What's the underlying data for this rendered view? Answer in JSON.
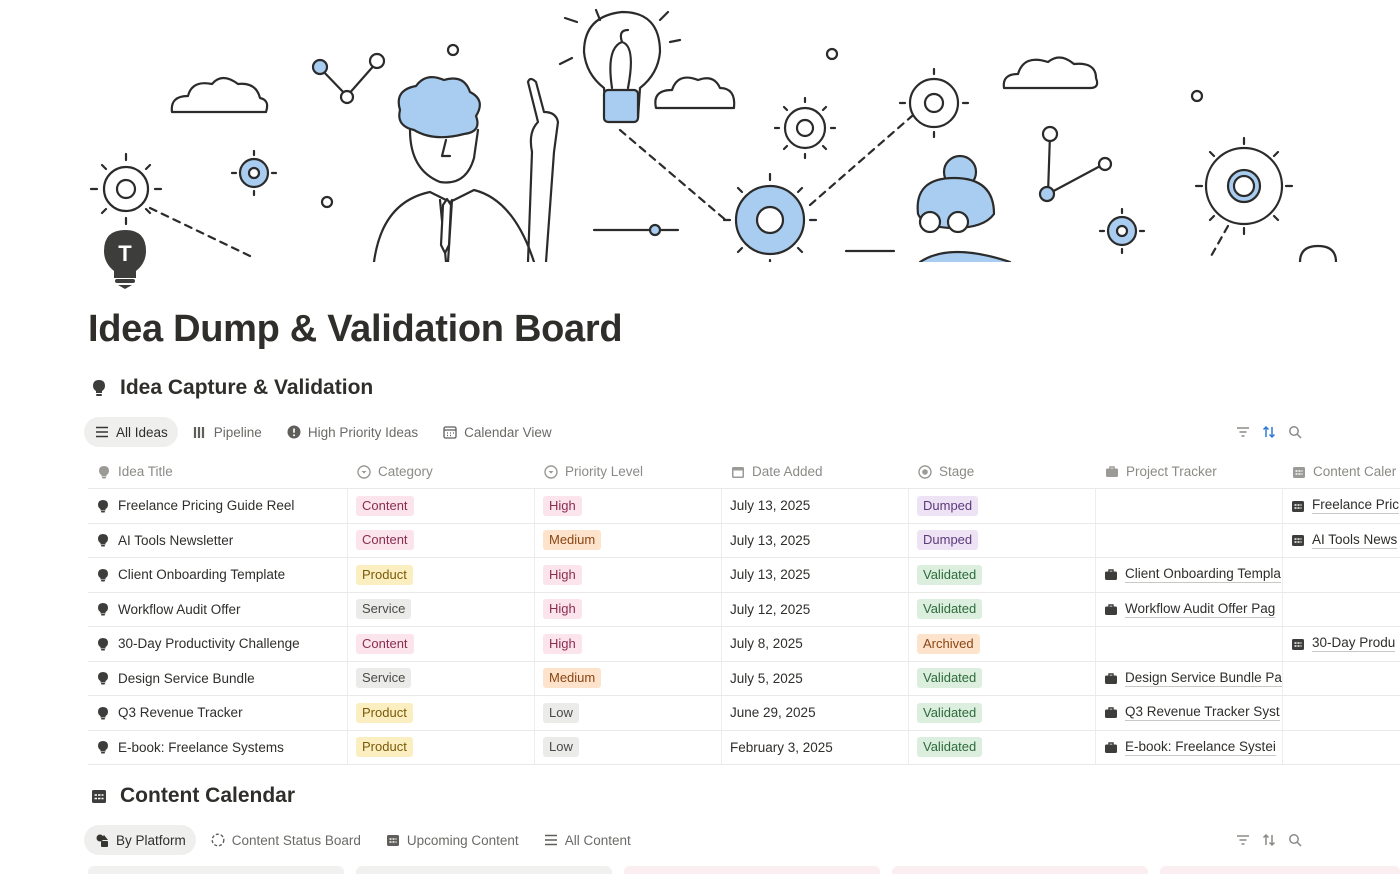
{
  "page": {
    "title": "Idea Dump & Validation Board",
    "icon": "lightbulb-t-icon",
    "icon_letter": "T"
  },
  "colors": {
    "accent_blue": "#2f7ad9",
    "cover_blue": "#a9cdf0",
    "text": "#2f2e2b",
    "muted": "#8b8a86"
  },
  "section1": {
    "title": "Idea Capture & Validation",
    "icon": "lightbulb-icon",
    "tabs": [
      {
        "label": "All Ideas",
        "icon": "list-icon",
        "active": true
      },
      {
        "label": "Pipeline",
        "icon": "board-columns-icon",
        "active": false
      },
      {
        "label": "High Priority Ideas",
        "icon": "alert-circle-icon",
        "active": false
      },
      {
        "label": "Calendar View",
        "icon": "calendar-icon",
        "active": false
      }
    ],
    "tools": [
      "filter-icon",
      "sort-icon",
      "search-icon"
    ],
    "columns": [
      {
        "label": "Idea Title",
        "icon": "lightbulb-icon"
      },
      {
        "label": "Category",
        "icon": "select-circle-icon"
      },
      {
        "label": "Priority Level",
        "icon": "select-circle-icon"
      },
      {
        "label": "Date Added",
        "icon": "calendar-icon"
      },
      {
        "label": "Stage",
        "icon": "status-icon"
      },
      {
        "label": "Project Tracker",
        "icon": "briefcase-icon"
      },
      {
        "label": "Content Caler",
        "icon": "calendar-grid-icon"
      }
    ],
    "rows": [
      {
        "title": "Freelance Pricing Guide Reel",
        "category": "Content",
        "priority": "High",
        "date": "July 13, 2025",
        "stage": "Dumped",
        "project": "",
        "content": "Freelance Pric"
      },
      {
        "title": "AI Tools Newsletter",
        "category": "Content",
        "priority": "Medium",
        "date": "July 13, 2025",
        "stage": "Dumped",
        "project": "",
        "content": "AI Tools News"
      },
      {
        "title": "Client Onboarding Template",
        "category": "Product",
        "priority": "High",
        "date": "July 13, 2025",
        "stage": "Validated",
        "project": "Client Onboarding Templa",
        "content": ""
      },
      {
        "title": "Workflow Audit Offer",
        "category": "Service",
        "priority": "High",
        "date": "July 12, 2025",
        "stage": "Validated",
        "project": "Workflow Audit Offer Pag",
        "content": ""
      },
      {
        "title": "30-Day Productivity Challenge",
        "category": "Content",
        "priority": "High",
        "date": "July 8, 2025",
        "stage": "Archived",
        "project": "",
        "content": "30-Day Produ"
      },
      {
        "title": "Design Service Bundle",
        "category": "Service",
        "priority": "Medium",
        "date": "July 5, 2025",
        "stage": "Validated",
        "project": "Design Service Bundle Pa",
        "content": ""
      },
      {
        "title": "Q3 Revenue Tracker",
        "category": "Product",
        "priority": "Low",
        "date": "June 29, 2025",
        "stage": "Validated",
        "project": "Q3 Revenue Tracker Syst",
        "content": ""
      },
      {
        "title": "E-book: Freelance Systems",
        "category": "Product",
        "priority": "Low",
        "date": "February 3, 2025",
        "stage": "Validated",
        "project": "E-book: Freelance Systei",
        "content": ""
      }
    ]
  },
  "tag_colors": {
    "Content": {
      "bg": "#fbe4ec",
      "fg": "#8b2d4f"
    },
    "Product": {
      "bg": "#fbeec0",
      "fg": "#7a5a0a"
    },
    "Service": {
      "bg": "#ebebea",
      "fg": "#4a4946"
    },
    "High": {
      "bg": "#fbe4ec",
      "fg": "#8b2d4f"
    },
    "Medium": {
      "bg": "#fde3cc",
      "fg": "#8a4513"
    },
    "Low": {
      "bg": "#ebebea",
      "fg": "#4a4946"
    },
    "Dumped": {
      "bg": "#eee3f5",
      "fg": "#5c3a7a"
    },
    "Validated": {
      "bg": "#dcefdf",
      "fg": "#2d6a3a"
    },
    "Archived": {
      "bg": "#fde3cc",
      "fg": "#8a4513"
    }
  },
  "section2": {
    "title": "Content Calendar",
    "icon": "calendar-grid-icon",
    "tabs": [
      {
        "label": "By Platform",
        "icon": "shapes-icon",
        "active": true
      },
      {
        "label": "Content Status Board",
        "icon": "dashed-circle-icon",
        "active": false
      },
      {
        "label": "Upcoming Content",
        "icon": "calendar-grid-icon",
        "active": false
      },
      {
        "label": "All Content",
        "icon": "list-icon",
        "active": false
      }
    ],
    "tools": [
      "filter-icon",
      "sort-icon",
      "search-icon"
    ]
  }
}
